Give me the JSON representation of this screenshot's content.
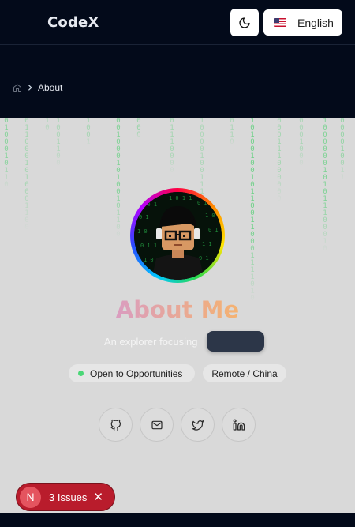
{
  "header": {
    "logo": "CodeX",
    "theme_toggle_icon": "moon-icon",
    "language": {
      "flag": "us-flag-icon",
      "label": "English"
    }
  },
  "breadcrumb": {
    "home_icon": "home-icon",
    "separator_icon": "chevron-right-icon",
    "current": "About"
  },
  "hero": {
    "title": "About Me",
    "subtitle": "An explorer focusing",
    "tags": [
      {
        "label": "Open to Opportunities",
        "status_color": "#4bd777"
      },
      {
        "label": "Remote / China"
      }
    ],
    "social_links": [
      {
        "icon": "github-icon"
      },
      {
        "icon": "mail-icon"
      },
      {
        "icon": "twitter-icon"
      },
      {
        "icon": "linkedin-icon"
      }
    ]
  },
  "issues_badge": {
    "initial": "N",
    "label": "3 Issues",
    "close_icon": "close-icon"
  },
  "colors": {
    "header_bg": "#030a1a",
    "hero_bg": "#d9d9d9",
    "title_start": "#d89bc6",
    "title_end": "#f7b46a",
    "badge_red": "#b91c2c",
    "rain_green": "#3ecf64"
  }
}
